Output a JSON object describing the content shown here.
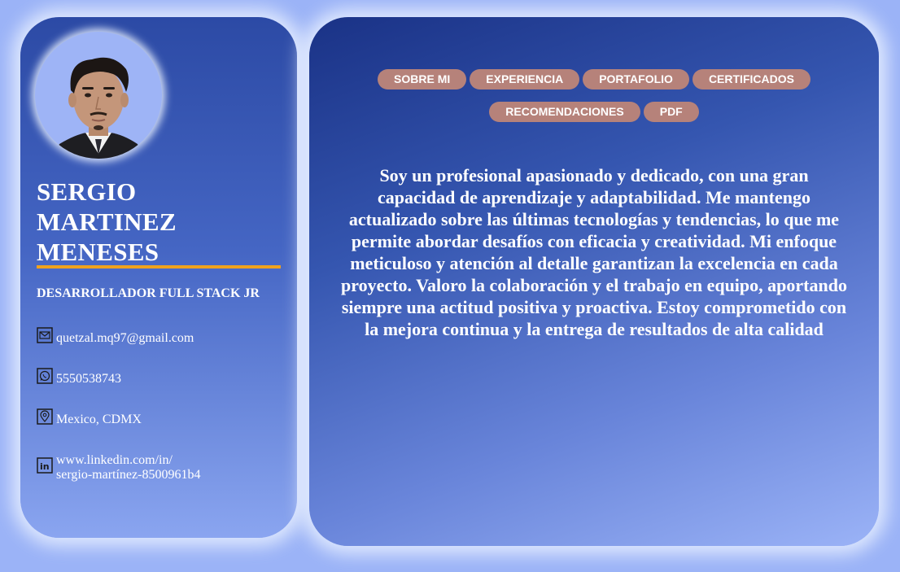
{
  "profile": {
    "name_lines": [
      "SERGIO",
      "MARTINEZ",
      "MENESES"
    ],
    "role": "DESARROLLADOR FULL STACK JR",
    "accent_color": "#f0a21d"
  },
  "contacts": {
    "email": {
      "icon": "mail-icon",
      "text": "quetzal.mq97@gmail.com"
    },
    "phone": {
      "icon": "whatsapp-icon",
      "text": "5550538743"
    },
    "location": {
      "icon": "location-pin-icon",
      "text": "Mexico, CDMX"
    },
    "linkedin": {
      "icon": "linkedin-icon",
      "text_line1": "www.linkedin.com/in/",
      "text_line2": "sergio-martínez-8500961b4"
    }
  },
  "nav": {
    "items": [
      "SOBRE MI",
      "EXPERIENCIA",
      "PORTAFOLIO",
      "CERTIFICADOS",
      "RECOMENDACIONES",
      "PDF"
    ],
    "button_color": "#b6827a"
  },
  "about": {
    "text": "Soy un profesional apasionado y dedicado, con una gran capacidad de aprendizaje y adaptabilidad. Me mantengo actualizado sobre las últimas tecnologías y tendencias, lo que me permite abordar desafíos con eficacia y creatividad. Mi enfoque meticuloso y atención al detalle garantizan la excelencia en cada proyecto. Valoro la colaboración y el trabajo en equipo, aportando siempre una actitud positiva y proactiva. Estoy comprometido con la mejora continua y la entrega de resultados de alta calidad"
  },
  "colors": {
    "page_background": "#9bb3f7",
    "sidebar_top": "#2c4aa5",
    "main_top": "#1a3286"
  }
}
